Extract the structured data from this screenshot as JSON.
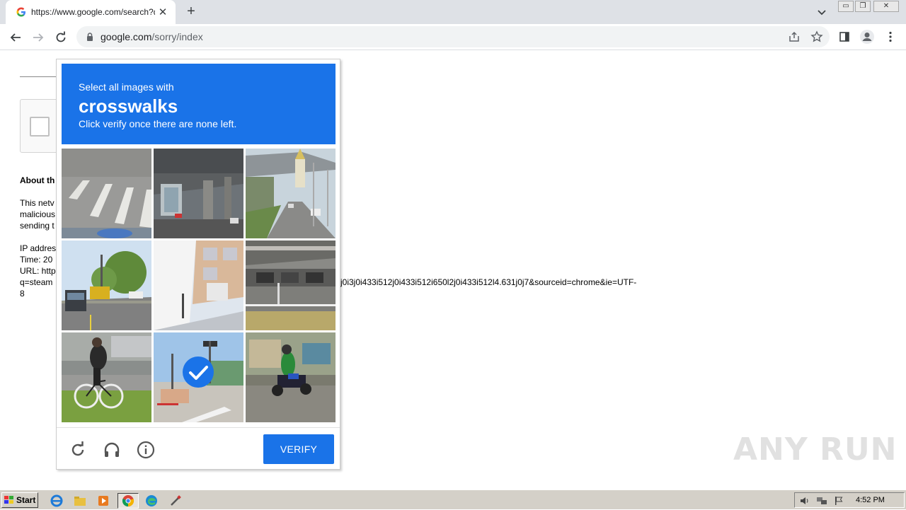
{
  "browser": {
    "tab": {
      "title": "https://www.google.com/search?q=",
      "favicon": "google-g-icon"
    },
    "omnibox": {
      "host": "google.com",
      "path": "/sorry/index"
    }
  },
  "page": {
    "about_heading": "About th",
    "paragraph_lines": [
      "This netv",
      "malicious",
      "sending t"
    ],
    "ip_line": "IP addres",
    "time_line": "Time: 20",
    "url_line": "URL: http",
    "query_line": "q=steam",
    "query_cont": "8",
    "url_tail": "j0i3j0i433i512j0i433i512i650l2j0i433i512l4.631j0j7&sourceid=chrome&ie=UTF-"
  },
  "challenge": {
    "line1": "Select all images with",
    "keyword": "crosswalks",
    "line3": "Click verify once there are none left.",
    "verify_label": "VERIFY",
    "tiles": [
      {
        "id": "tile-1",
        "selected": false
      },
      {
        "id": "tile-2",
        "selected": false
      },
      {
        "id": "tile-3",
        "selected": false
      },
      {
        "id": "tile-4",
        "selected": false
      },
      {
        "id": "tile-5",
        "selected": false
      },
      {
        "id": "tile-6",
        "selected": false
      },
      {
        "id": "tile-7",
        "selected": false
      },
      {
        "id": "tile-8",
        "selected": true
      },
      {
        "id": "tile-9",
        "selected": false
      }
    ],
    "accent": "#1a73e8"
  },
  "watermark": "ANY RUN",
  "taskbar": {
    "start_label": "Start",
    "clock": "4:52 PM"
  }
}
